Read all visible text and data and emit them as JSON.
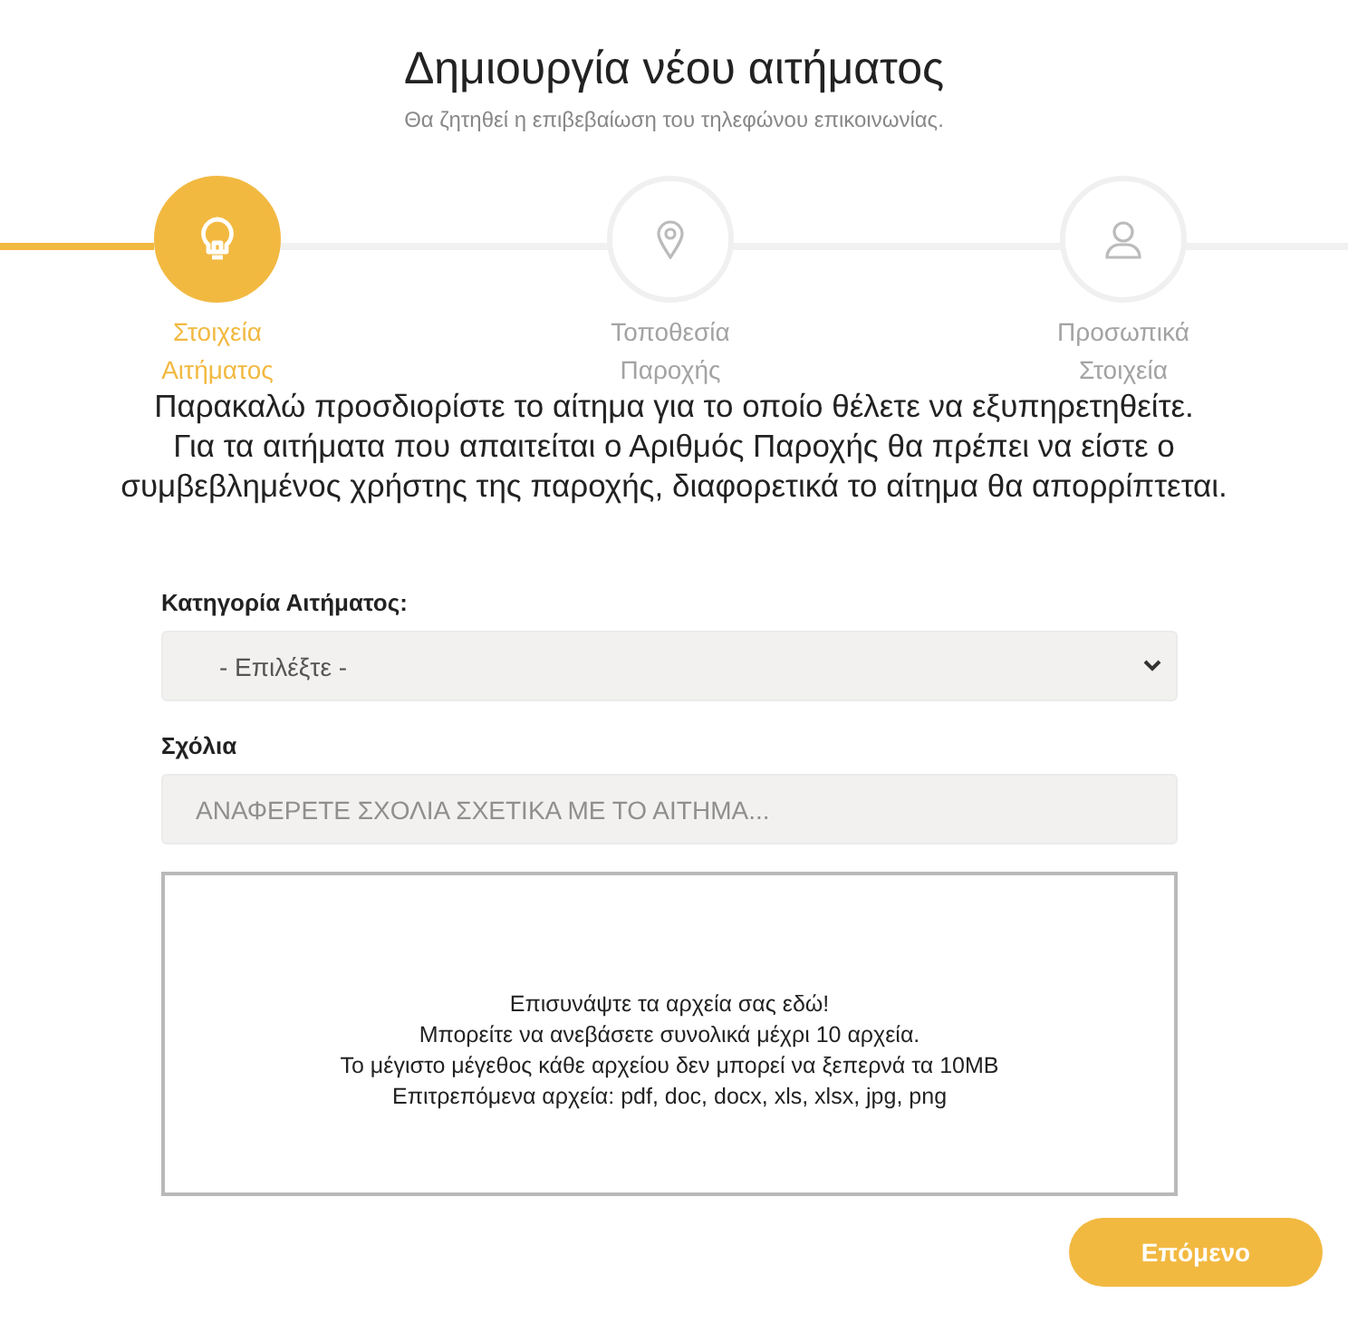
{
  "header": {
    "title": "Δημιουργία νέου αιτήματος",
    "subtitle": "Θα ζητηθεί η επιβεβαίωση του τηλεφώνου επικοινωνίας."
  },
  "steps": [
    {
      "label": "Στοιχεία Αιτήματος",
      "kind": "bulb",
      "selected": true
    },
    {
      "label": "Τοποθεσία Παροχής",
      "kind": "pin",
      "selected": false
    },
    {
      "label": "Προσωπικά Στοιχεία",
      "kind": "person",
      "selected": false
    }
  ],
  "instructions": [
    "Παρακαλώ προσδιορίστε το αίτημα για το οποίο θέλετε να εξυπηρετηθείτε.",
    "Για τα αιτήματα που απαιτείται ο Αριθμός Παροχής θα πρέπει να είστε ο συμβεβλημένος χρήστης της παροχής, διαφορετικά το αίτημα θα απορρίπτεται."
  ],
  "form": {
    "category": {
      "label": "Κατηγορία Αιτήματος:",
      "value": "- Επιλέξτε -"
    },
    "comments": {
      "label": "Σχόλια",
      "placeholder": "ΑΝΑΦΕΡΕΤΕ ΣΧΟΛΙΑ ΣΧΕΤΙΚΑ ΜΕ ΤΟ ΑΙΤΗΜΑ..."
    },
    "dropzone": [
      "Επισυνάψτε τα αρχεία σας εδώ!",
      "Μπορείτε να ανεβάσετε συνολικά μέχρι 10 αρχεία.",
      "Το μέγιστο μέγεθος κάθε αρχείου δεν μπορεί να ξεπερνά τα 10MB",
      "Επιτρεπόμενα αρχεία: pdf, doc, docx, xls, xlsx, jpg, png"
    ]
  },
  "next_button": "Επόμενο"
}
